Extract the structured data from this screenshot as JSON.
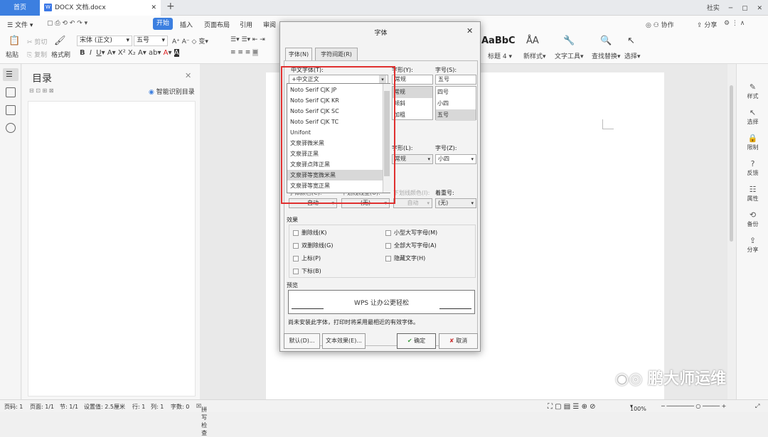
{
  "tabs": {
    "home": "首页",
    "doc": "DOCX 文档.docx"
  },
  "window": {
    "community": "社实",
    "share": "分享",
    "collab": "协作"
  },
  "menu": [
    "文件",
    "开始",
    "插入",
    "页面布局",
    "引用",
    "审阅"
  ],
  "toolbar": {
    "paste": "粘贴",
    "cut": "剪切",
    "copy": "复制",
    "format_painter": "格式刷",
    "font_name": "宋体 (正文)",
    "font_size": "五号",
    "style_preview": "AaBbC",
    "style_heading": "标题 4",
    "new_style": "新样式",
    "text_tools": "文字工具",
    "find_replace": "查找替换",
    "select": "选择"
  },
  "toc": {
    "title": "目录",
    "smart": "智能识别目录"
  },
  "right_panel": [
    "样式",
    "选择",
    "限制",
    "反馈",
    "属性",
    "备份",
    "分享"
  ],
  "statusbar": {
    "page": "页码: 1",
    "pages": "页面: 1/1",
    "section": "节: 1/1",
    "setting": "设置值: 2.5厘米",
    "row": "行: 1",
    "col": "列: 1",
    "words": "字数: 0",
    "spell": "拼写检查",
    "zoom": "100%"
  },
  "watermark": "鹏大师运维",
  "dialog": {
    "title": "字体",
    "tab_font": "字体(N)",
    "tab_spacing": "字符间距(R)",
    "cn_font_label": "中文字体(T):",
    "cn_font_value": "+中文正文",
    "style_label": "字形(Y):",
    "style_value": "常规",
    "style_list": [
      "常规",
      "倾斜",
      "加粗"
    ],
    "size_label": "字号(S):",
    "size_value": "五号",
    "size_list": [
      "四号",
      "小四",
      "五号"
    ],
    "style2_label": "字形(L):",
    "style2_value": "常规",
    "size2_label": "字号(Z):",
    "size2_value": "小四",
    "color_label": "字体颜色(C):",
    "color_value": "自动",
    "underline_label": "下划线线型(U):",
    "underline_value": "(无)",
    "ucolor_label": "下划线颜色(I):",
    "ucolor_value": "自动",
    "emph_label": "着重号:",
    "emph_value": "(无)",
    "effects_label": "效果",
    "effects_left": [
      "删除线(K)",
      "双删除线(G)",
      "上标(P)",
      "下标(B)"
    ],
    "effects_right": [
      "小型大写字母(M)",
      "全部大写字母(A)",
      "隐藏文字(H)"
    ],
    "preview_label": "预览",
    "preview_text": "WPS 让办公更轻松",
    "note": "尚未安装此字体，打印时将采用最相近的有效字体。",
    "btn_default": "默认(D)...",
    "btn_effects": "文本效果(E)...",
    "btn_ok": "确定",
    "btn_cancel": "取消"
  },
  "font_dropdown": [
    "Noto Serif CJK JP",
    "Noto Serif CJK KR",
    "Noto Serif CJK SC",
    "Noto Serif CJK TC",
    "Unifont",
    "文泉驿微米黑",
    "文泉驿正黑",
    "文泉驿点阵正黑",
    "文泉驿等宽微米黑",
    "文泉驿等宽正黑"
  ],
  "colors": {
    "accent": "#3c7fe0",
    "highlight_box": "#e0302f"
  }
}
